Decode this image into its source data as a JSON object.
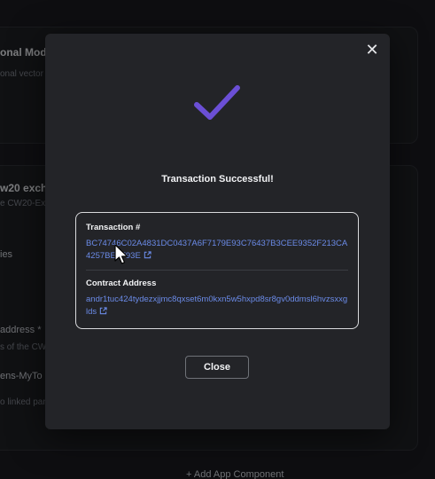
{
  "background": {
    "item1_title": "onal Modu",
    "item1_sub": "onal vector",
    "item2_title": "w20 excha",
    "item2_sub": "e CW20-Ex",
    "item3_title": "ies",
    "item4_title": "address *",
    "item4_sub": "s of the CW",
    "item5_title": "ens-MyTo",
    "item6_sub": "o linked pan",
    "add_component": "+ Add App Component"
  },
  "modal": {
    "title": "Transaction Successful!",
    "transaction_label": "Transaction #",
    "transaction_hash": "BC74746C02A4831DC0437A6F7179E93C76437B3CEE9352F213CA4257BE6F93E",
    "contract_label": "Contract Address",
    "contract_address": "andr1tuc424tydezxjjmc8qxset6m0kxn5w5hxpd8sr8gv0ddmsl6hvzsxxglds",
    "close_button": "Close",
    "close_icon": "close-icon",
    "success_icon": "checkmark-icon",
    "external_link_icon": "external-link-icon"
  },
  "colors": {
    "accent": "#6b4fd6",
    "link": "#6b8be8",
    "modal_bg": "#232428"
  }
}
